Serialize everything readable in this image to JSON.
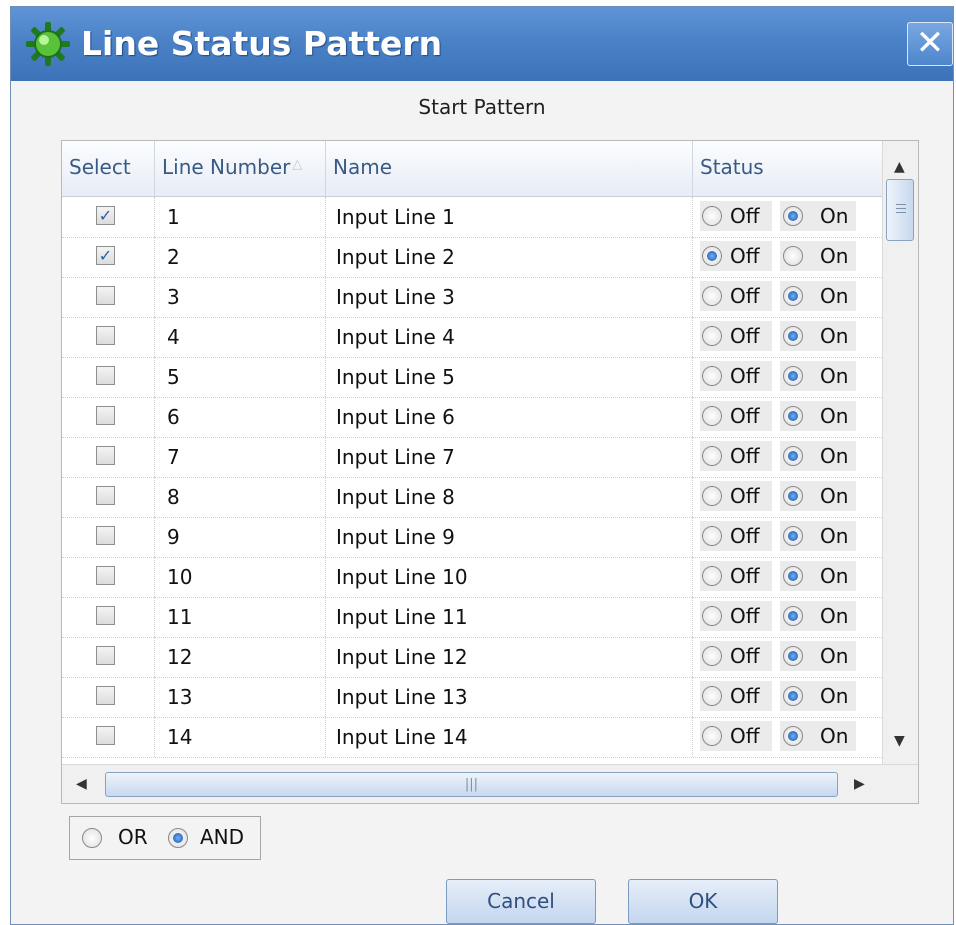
{
  "window": {
    "title": "Line Status Pattern",
    "close_glyph": "✕"
  },
  "section_title": "Start Pattern",
  "table": {
    "columns": [
      "Select",
      "Line Number",
      "Name",
      "Status"
    ],
    "sort_indicator": "△",
    "status_labels": {
      "off": "Off",
      "on": "On"
    },
    "rows": [
      {
        "selected": true,
        "number": "1",
        "name": "Input Line 1",
        "status": "On"
      },
      {
        "selected": true,
        "number": "2",
        "name": "Input Line 2",
        "status": "Off"
      },
      {
        "selected": false,
        "number": "3",
        "name": "Input Line 3",
        "status": "On"
      },
      {
        "selected": false,
        "number": "4",
        "name": "Input Line 4",
        "status": "On"
      },
      {
        "selected": false,
        "number": "5",
        "name": "Input Line 5",
        "status": "On"
      },
      {
        "selected": false,
        "number": "6",
        "name": "Input Line 6",
        "status": "On"
      },
      {
        "selected": false,
        "number": "7",
        "name": "Input Line 7",
        "status": "On"
      },
      {
        "selected": false,
        "number": "8",
        "name": "Input Line 8",
        "status": "On"
      },
      {
        "selected": false,
        "number": "9",
        "name": "Input Line 9",
        "status": "On"
      },
      {
        "selected": false,
        "number": "10",
        "name": "Input Line 10",
        "status": "On"
      },
      {
        "selected": false,
        "number": "11",
        "name": "Input Line 11",
        "status": "On"
      },
      {
        "selected": false,
        "number": "12",
        "name": "Input Line 12",
        "status": "On"
      },
      {
        "selected": false,
        "number": "13",
        "name": "Input Line 13",
        "status": "On"
      },
      {
        "selected": false,
        "number": "14",
        "name": "Input Line 14",
        "status": "On"
      }
    ]
  },
  "scrollbars": {
    "up": "▲",
    "down": "▼",
    "left": "◀",
    "right": "▶",
    "h_grip": "|||"
  },
  "logic": {
    "or_label": "OR",
    "and_label": "AND",
    "selected": "AND"
  },
  "buttons": {
    "cancel": "Cancel",
    "ok": "OK"
  },
  "colors": {
    "title_bar": "#4b82c7",
    "header_text": "#3a5a86",
    "radio_selected": "#1a4f9c"
  }
}
